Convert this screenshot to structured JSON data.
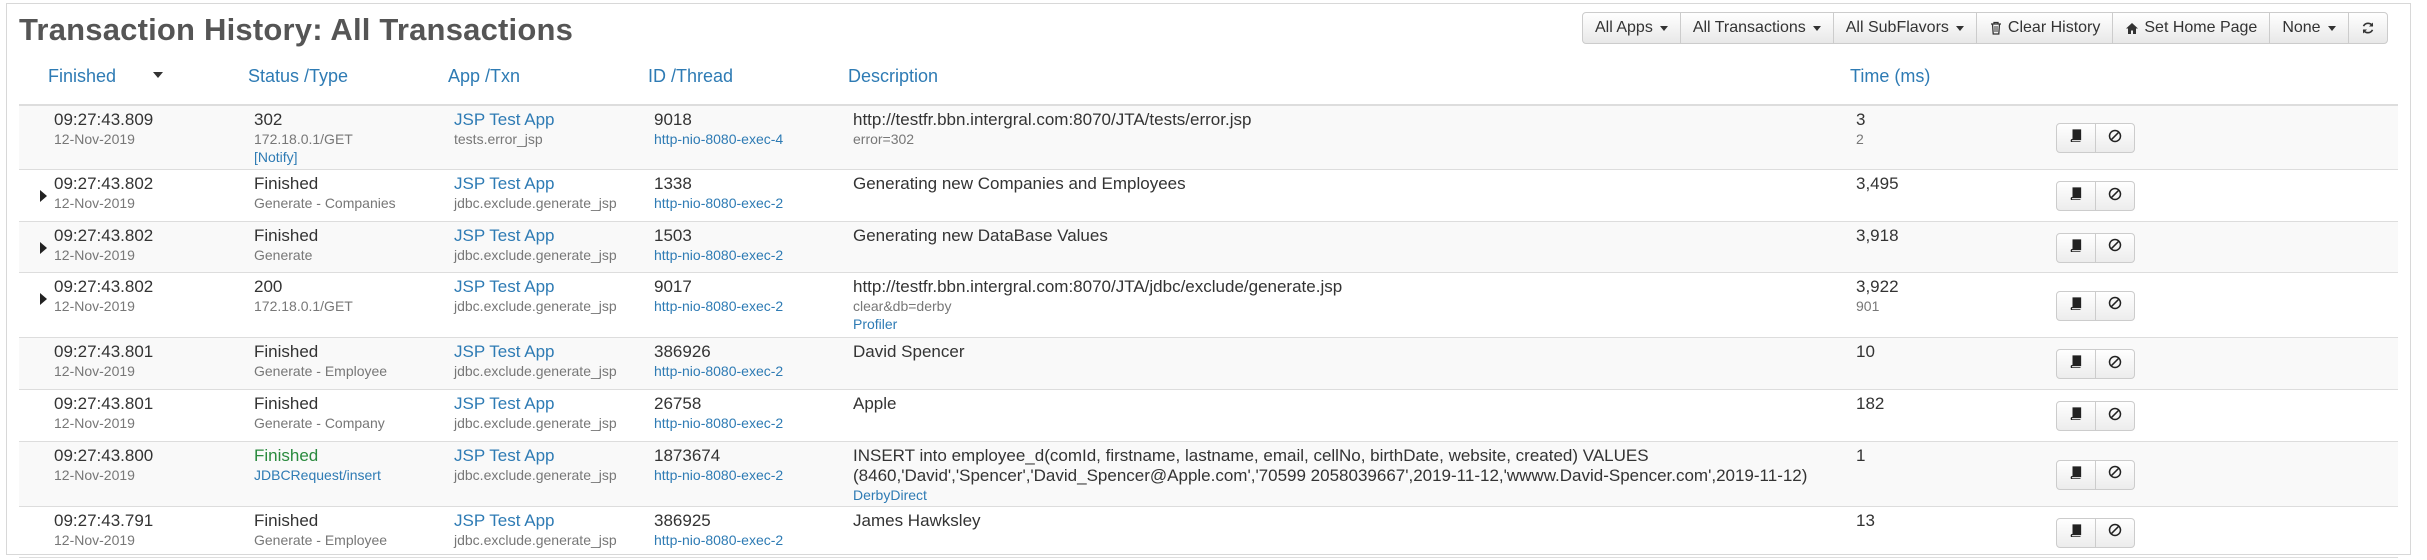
{
  "page": {
    "title": "Transaction History: All Transactions"
  },
  "toolbar": {
    "all_apps": "All Apps",
    "all_transactions": "All Transactions",
    "all_subflavors": "All SubFlavors",
    "clear_history": "Clear History",
    "set_home_page": "Set Home Page",
    "none": "None"
  },
  "columns": {
    "finished": "Finished",
    "status_type": "Status /Type",
    "app_txn": "App /Txn",
    "id_thread": "ID /Thread",
    "description": "Description",
    "time_ms": "Time (ms)"
  },
  "rows": [
    {
      "expandable": false,
      "time": "09:27:43.809",
      "date": "12-Nov-2019",
      "status": "302",
      "status_green": false,
      "type": "172.18.0.1/GET",
      "type_link": false,
      "extra": "[Notify]",
      "app": "JSP Test App",
      "txn": "tests.error_jsp",
      "id": "9018",
      "thread": "http-nio-8080-exec-4",
      "desc1": "http://testfr.bbn.intergral.com:8070/JTA/tests/error.jsp",
      "desc2": "",
      "desc_sub": "error=302",
      "desc_link": "",
      "ms": "3",
      "ms_sub": "2"
    },
    {
      "expandable": true,
      "time": "09:27:43.802",
      "date": "12-Nov-2019",
      "status": "Finished",
      "status_green": false,
      "type": "Generate - Companies",
      "type_link": false,
      "extra": "",
      "app": "JSP Test App",
      "txn": "jdbc.exclude.generate_jsp",
      "id": "1338",
      "thread": "http-nio-8080-exec-2",
      "desc1": "Generating new Companies and Employees",
      "desc2": "",
      "desc_sub": "",
      "desc_link": "",
      "ms": "3,495",
      "ms_sub": ""
    },
    {
      "expandable": true,
      "time": "09:27:43.802",
      "date": "12-Nov-2019",
      "status": "Finished",
      "status_green": false,
      "type": "Generate",
      "type_link": false,
      "extra": "",
      "app": "JSP Test App",
      "txn": "jdbc.exclude.generate_jsp",
      "id": "1503",
      "thread": "http-nio-8080-exec-2",
      "desc1": "Generating new DataBase Values",
      "desc2": "",
      "desc_sub": "",
      "desc_link": "",
      "ms": "3,918",
      "ms_sub": ""
    },
    {
      "expandable": true,
      "time": "09:27:43.802",
      "date": "12-Nov-2019",
      "status": "200",
      "status_green": false,
      "type": "172.18.0.1/GET",
      "type_link": false,
      "extra": "",
      "app": "JSP Test App",
      "txn": "jdbc.exclude.generate_jsp",
      "id": "9017",
      "thread": "http-nio-8080-exec-2",
      "desc1": "http://testfr.bbn.intergral.com:8070/JTA/jdbc/exclude/generate.jsp",
      "desc2": "",
      "desc_sub": "clear&db=derby",
      "desc_link": "Profiler",
      "ms": "3,922",
      "ms_sub": "901"
    },
    {
      "expandable": false,
      "time": "09:27:43.801",
      "date": "12-Nov-2019",
      "status": "Finished",
      "status_green": false,
      "type": "Generate - Employee",
      "type_link": false,
      "extra": "",
      "app": "JSP Test App",
      "txn": "jdbc.exclude.generate_jsp",
      "id": "386926",
      "thread": "http-nio-8080-exec-2",
      "desc1": "David Spencer",
      "desc2": "",
      "desc_sub": "",
      "desc_link": "",
      "ms": "10",
      "ms_sub": ""
    },
    {
      "expandable": false,
      "time": "09:27:43.801",
      "date": "12-Nov-2019",
      "status": "Finished",
      "status_green": false,
      "type": "Generate - Company",
      "type_link": false,
      "extra": "",
      "app": "JSP Test App",
      "txn": "jdbc.exclude.generate_jsp",
      "id": "26758",
      "thread": "http-nio-8080-exec-2",
      "desc1": "Apple",
      "desc2": "",
      "desc_sub": "",
      "desc_link": "",
      "ms": "182",
      "ms_sub": ""
    },
    {
      "expandable": false,
      "time": "09:27:43.800",
      "date": "12-Nov-2019",
      "status": "Finished",
      "status_green": true,
      "type": "JDBCRequest/insert",
      "type_link": true,
      "extra": "",
      "app": "JSP Test App",
      "txn": "jdbc.exclude.generate_jsp",
      "id": "1873674",
      "thread": "http-nio-8080-exec-2",
      "desc1": "INSERT into employee_d(comId, firstname, lastname, email, cellNo, birthDate, website, created) VALUES",
      "desc2": "(8460,'David','Spencer','David_Spencer@Apple.com','70599 2058039667',2019-11-12,'wwww.David-Spencer.com',2019-11-12)",
      "desc_sub": "",
      "desc_link": "DerbyDirect",
      "ms": "1",
      "ms_sub": ""
    },
    {
      "expandable": false,
      "time": "09:27:43.791",
      "date": "12-Nov-2019",
      "status": "Finished",
      "status_green": false,
      "type": "Generate - Employee",
      "type_link": false,
      "extra": "",
      "app": "JSP Test App",
      "txn": "jdbc.exclude.generate_jsp",
      "id": "386925",
      "thread": "http-nio-8080-exec-2",
      "desc1": "James Hawksley",
      "desc2": "",
      "desc_sub": "",
      "desc_link": "",
      "ms": "13",
      "ms_sub": ""
    }
  ],
  "colors": {
    "link": "#2e7bb4",
    "green": "#2a8a3e",
    "header_line": "#dddddd"
  }
}
